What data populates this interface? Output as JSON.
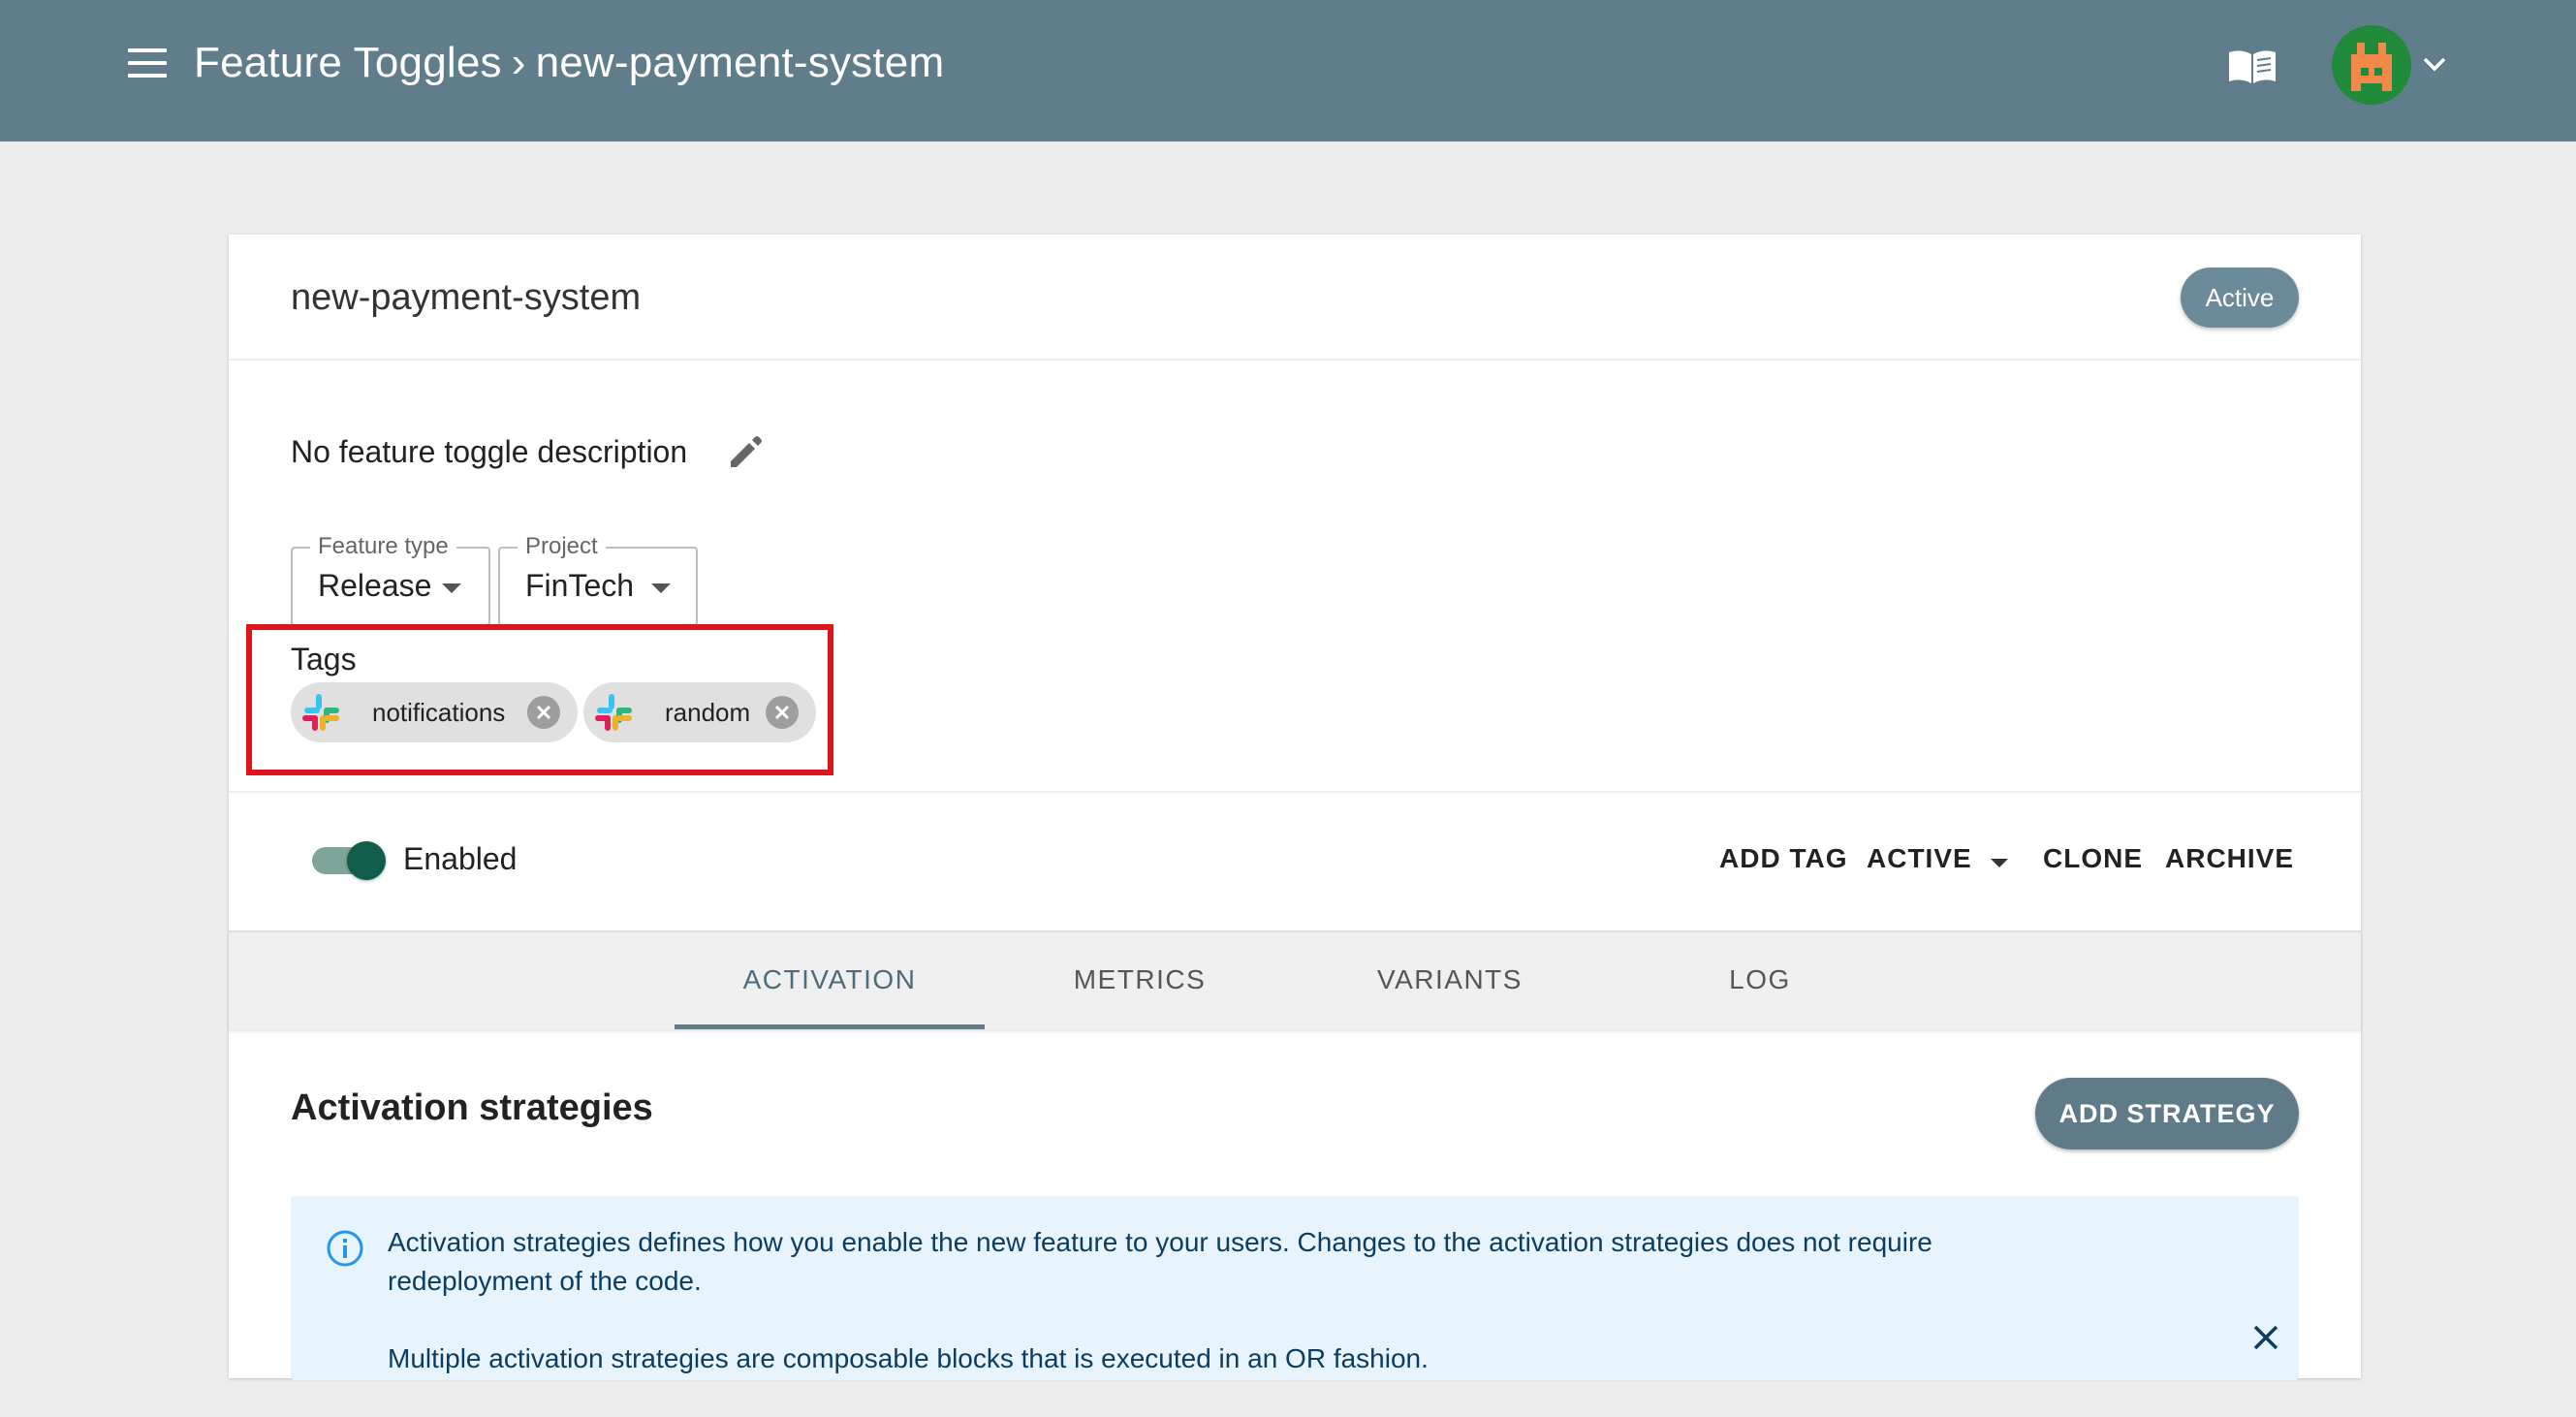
{
  "header": {
    "breadcrumb_root": "Feature Toggles",
    "breadcrumb_separator": "›",
    "breadcrumb_current": "new-payment-system",
    "docs_icon": "book-icon",
    "avatar_icon": "avatar",
    "menu_icon": "menu-icon"
  },
  "feature": {
    "name": "new-payment-system",
    "status_badge": "Active",
    "description": "No feature toggle description",
    "feature_type": {
      "label": "Feature type",
      "value": "Release"
    },
    "project": {
      "label": "Project",
      "value": "FinTech"
    },
    "tags_label": "Tags",
    "tags": [
      {
        "label": "notifications",
        "icon": "slack-icon"
      },
      {
        "label": "random",
        "icon": "slack-icon"
      }
    ],
    "enabled": true,
    "enabled_label": "Enabled"
  },
  "actions": {
    "add_tag": "ADD TAG",
    "active": "ACTIVE",
    "clone": "CLONE",
    "archive": "ARCHIVE"
  },
  "tabs": [
    {
      "label": "ACTIVATION",
      "active": true
    },
    {
      "label": "METRICS",
      "active": false
    },
    {
      "label": "VARIANTS",
      "active": false
    },
    {
      "label": "LOG",
      "active": false
    }
  ],
  "activation": {
    "title": "Activation strategies",
    "add_strategy": "ADD STRATEGY",
    "info_line_1": "Activation strategies defines how you enable the new feature to your users. Changes to the activation strategies does not require redeployment of the code.",
    "info_line_2": "Multiple activation strategies are composable blocks that is executed in an OR fashion."
  },
  "colors": {
    "appbar": "#607d8b",
    "highlight": "#e0141c",
    "toggle_on": "#0f5d4a",
    "info_bg": "#e8f4fd"
  }
}
